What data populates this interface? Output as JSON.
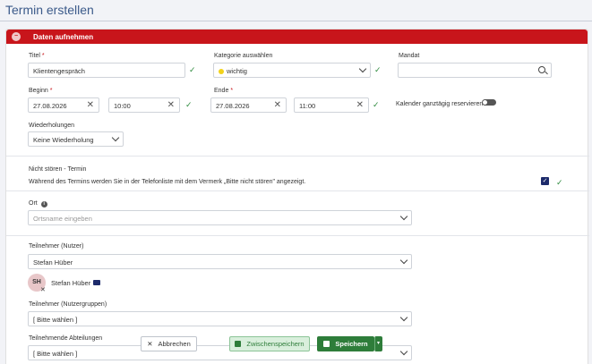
{
  "page": {
    "title": "Termin erstellen"
  },
  "panel": {
    "header": "Daten aufnehmen"
  },
  "form": {
    "titel": {
      "label": "Titel",
      "required": "*",
      "value": "Klientengespräch"
    },
    "kategorie": {
      "label": "Kategorie auswählen",
      "value": "wichtig",
      "dot_color": "#f2d21a"
    },
    "mandat": {
      "label": "Mandat",
      "value": ""
    },
    "beginn": {
      "label": "Beginn",
      "required": "*",
      "date": "27.08.2026",
      "time": "10:00"
    },
    "ende": {
      "label": "Ende",
      "required": "*",
      "date": "27.08.2026",
      "time": "11:00"
    },
    "ganztaegig": {
      "label": "Kalender ganztägig reservieren",
      "checked": false
    },
    "wiederholungen": {
      "label": "Wiederholungen",
      "value": "Keine Wiederholung"
    },
    "nicht_stoeren": {
      "label": "Nicht stören - Termin",
      "description": "Während des Termins werden Sie in der Telefonliste mit dem Vermerk „Bitte nicht stören\" angezeigt.",
      "checked": true
    },
    "ort": {
      "label": "Ort",
      "info": "i",
      "placeholder": "Ortsname eingeben"
    },
    "teilnehmer_nutzer": {
      "label": "Teilnehmer (Nutzer)",
      "value": "Stefan Hüber",
      "selected": {
        "initials": "SH",
        "name": "Stefan Hüber",
        "remove": "✕"
      }
    },
    "teilnehmer_gruppen": {
      "label": "Teilnehmer (Nutzergruppen)",
      "value": "[ Bitte wählen ]"
    },
    "teilnehmende_abteilungen": {
      "label": "Teilnehmende Abteilungen",
      "value": "[ Bitte wählen ]"
    }
  },
  "actions": {
    "cancel": {
      "label": "Abbrechen",
      "icon": "✕"
    },
    "save_draft": {
      "label": "Zwischenspeichern"
    },
    "save": {
      "label": "Speichern"
    },
    "save_menu": {
      "icon": "▾"
    }
  },
  "icons": {
    "check": "✓",
    "clear": "✕"
  },
  "colors": {
    "accent": "#c8151b",
    "success": "#2e7d3a",
    "title": "#3b5a8a",
    "checkbox": "#1d2b6b"
  }
}
